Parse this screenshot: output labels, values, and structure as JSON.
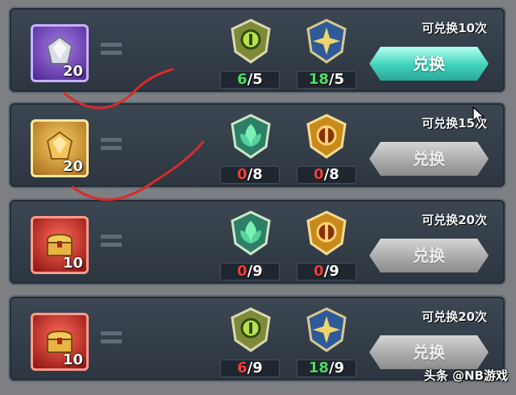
{
  "rows": [
    {
      "item": {
        "kind": "silver-gem-icon",
        "count": "20",
        "frame_color": "#7d4ad8"
      },
      "costs": [
        {
          "icon": "green-emblem-icon",
          "have": "6",
          "need": "5",
          "status": "ok"
        },
        {
          "icon": "blue-star-emblem-icon",
          "have": "18",
          "need": "5",
          "status": "ok"
        }
      ],
      "limit": "可兑换10次",
      "button": {
        "label": "兑换",
        "state": "active"
      }
    },
    {
      "item": {
        "kind": "gold-gem-icon",
        "count": "20",
        "frame_color": "#d49a2c"
      },
      "costs": [
        {
          "icon": "green-leaf-emblem-icon",
          "have": "0",
          "need": "8",
          "status": "bad"
        },
        {
          "icon": "gold-emblem-icon",
          "have": "0",
          "need": "8",
          "status": "bad"
        }
      ],
      "limit": "可兑换15次",
      "button": {
        "label": "兑换",
        "state": "disabled"
      }
    },
    {
      "item": {
        "kind": "treasure-chest-icon",
        "count": "10",
        "frame_color": "#c92a20"
      },
      "costs": [
        {
          "icon": "green-leaf-emblem-icon",
          "have": "0",
          "need": "9",
          "status": "bad"
        },
        {
          "icon": "gold-emblem-icon",
          "have": "0",
          "need": "9",
          "status": "bad"
        }
      ],
      "limit": "可兑换20次",
      "button": {
        "label": "兑换",
        "state": "disabled"
      }
    },
    {
      "item": {
        "kind": "treasure-chest-icon",
        "count": "10",
        "frame_color": "#c92a20"
      },
      "costs": [
        {
          "icon": "green-emblem-icon",
          "have": "6",
          "need": "9",
          "status": "bad"
        },
        {
          "icon": "blue-star-emblem-icon",
          "have": "18",
          "need": "9",
          "status": "ok"
        }
      ],
      "limit": "可兑换20次",
      "button": {
        "label": "兑换",
        "state": "disabled"
      }
    }
  ],
  "separator": "/",
  "watermark": "头条 @NB游戏",
  "colors": {
    "ok": "#49e060",
    "bad": "#f13d3d",
    "annotation": "#d92b2b"
  }
}
